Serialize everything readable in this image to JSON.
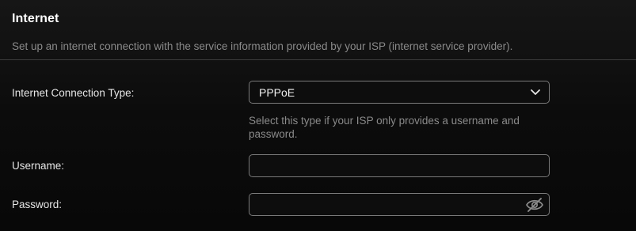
{
  "section": {
    "title": "Internet",
    "description": "Set up an internet connection with the service information provided by your ISP (internet service provider)."
  },
  "connection_type": {
    "label": "Internet Connection Type:",
    "selected": "PPPoE",
    "hint": "Select this type if your ISP only provides a username and password."
  },
  "username": {
    "label": "Username:",
    "value": ""
  },
  "password": {
    "label": "Password:",
    "value": "",
    "visibility_icon": "eye-slash-icon"
  }
}
